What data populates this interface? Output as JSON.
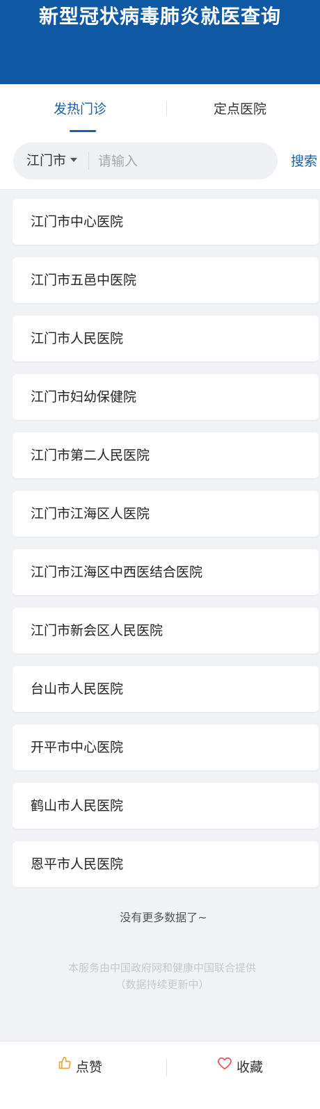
{
  "header": {
    "title": "新型冠状病毒肺炎就医查询"
  },
  "tabs": [
    {
      "label": "发热门诊",
      "active": true
    },
    {
      "label": "定点医院",
      "active": false
    }
  ],
  "search": {
    "city": "江门市",
    "placeholder": "请输入",
    "value": "",
    "button_label": "搜索"
  },
  "hospitals": [
    {
      "name": "江门市中心医院"
    },
    {
      "name": "江门市五邑中医院"
    },
    {
      "name": "江门市人民医院"
    },
    {
      "name": "江门市妇幼保健院"
    },
    {
      "name": "江门市第二人民医院"
    },
    {
      "name": "江门市江海区人医院"
    },
    {
      "name": "江门市江海区中西医结合医院"
    },
    {
      "name": "江门市新会区人民医院"
    },
    {
      "name": "台山市人民医院"
    },
    {
      "name": "开平市中心医院"
    },
    {
      "name": "鹤山市人民医院"
    },
    {
      "name": "恩平市人民医院"
    }
  ],
  "status": {
    "no_more": "没有更多数据了~"
  },
  "footer": {
    "line1": "本服务由中国政府网和健康中国联合提供",
    "line2": "（数据持续更新中）"
  },
  "bottom_bar": {
    "like_label": "点赞",
    "favorite_label": "收藏"
  },
  "colors": {
    "header_bg": "#0f59a4",
    "accent": "#1a5fa8",
    "like_icon": "#e7a33e",
    "favorite_icon": "#e05a5a"
  },
  "icons": {
    "like": "thumbs-up-icon",
    "favorite": "heart-icon",
    "city_select": "caret-down-icon"
  }
}
